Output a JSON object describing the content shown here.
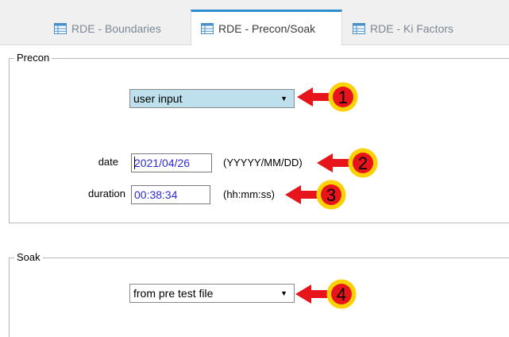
{
  "tabs": [
    {
      "label": "RDE - Boundaries",
      "icon": "table-icon",
      "active": false
    },
    {
      "label": "RDE - Precon/Soak",
      "icon": "table-icon",
      "active": true
    },
    {
      "label": "RDE - Ki Factors",
      "icon": "table-icon",
      "active": false
    }
  ],
  "precon": {
    "legend": "Precon",
    "mode_select": {
      "value": "user input"
    },
    "date": {
      "label": "date",
      "value": "2021/04/26",
      "format_hint": "(YYYYY/MM/DD)"
    },
    "duration": {
      "label": "duration",
      "value": "00:38:34",
      "format_hint": "(hh:mm:ss)"
    }
  },
  "soak": {
    "legend": "Soak",
    "mode_select": {
      "value": "from pre test file"
    }
  },
  "callouts": [
    "1",
    "2",
    "3",
    "4"
  ],
  "colors": {
    "tab_accent": "#2d8ecf",
    "selected_combo": "#bde0ec",
    "field_text": "#2c2cd6",
    "callout_arrow": "#e8141b",
    "callout_badge": "#fcd205"
  }
}
